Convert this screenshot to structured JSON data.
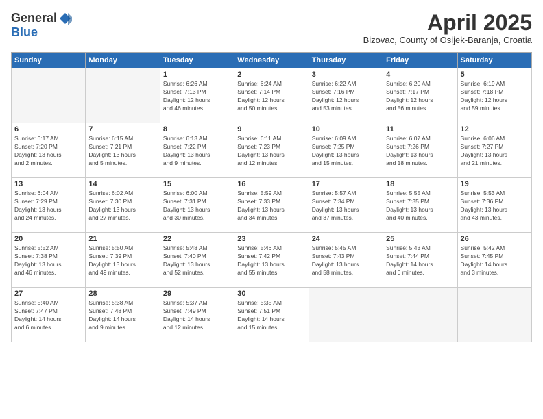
{
  "header": {
    "logo_general": "General",
    "logo_blue": "Blue",
    "month_title": "April 2025",
    "location": "Bizovac, County of Osijek-Baranja, Croatia"
  },
  "days_of_week": [
    "Sunday",
    "Monday",
    "Tuesday",
    "Wednesday",
    "Thursday",
    "Friday",
    "Saturday"
  ],
  "weeks": [
    [
      {
        "day": "",
        "info": ""
      },
      {
        "day": "",
        "info": ""
      },
      {
        "day": "1",
        "info": "Sunrise: 6:26 AM\nSunset: 7:13 PM\nDaylight: 12 hours\nand 46 minutes."
      },
      {
        "day": "2",
        "info": "Sunrise: 6:24 AM\nSunset: 7:14 PM\nDaylight: 12 hours\nand 50 minutes."
      },
      {
        "day": "3",
        "info": "Sunrise: 6:22 AM\nSunset: 7:16 PM\nDaylight: 12 hours\nand 53 minutes."
      },
      {
        "day": "4",
        "info": "Sunrise: 6:20 AM\nSunset: 7:17 PM\nDaylight: 12 hours\nand 56 minutes."
      },
      {
        "day": "5",
        "info": "Sunrise: 6:19 AM\nSunset: 7:18 PM\nDaylight: 12 hours\nand 59 minutes."
      }
    ],
    [
      {
        "day": "6",
        "info": "Sunrise: 6:17 AM\nSunset: 7:20 PM\nDaylight: 13 hours\nand 2 minutes."
      },
      {
        "day": "7",
        "info": "Sunrise: 6:15 AM\nSunset: 7:21 PM\nDaylight: 13 hours\nand 5 minutes."
      },
      {
        "day": "8",
        "info": "Sunrise: 6:13 AM\nSunset: 7:22 PM\nDaylight: 13 hours\nand 9 minutes."
      },
      {
        "day": "9",
        "info": "Sunrise: 6:11 AM\nSunset: 7:23 PM\nDaylight: 13 hours\nand 12 minutes."
      },
      {
        "day": "10",
        "info": "Sunrise: 6:09 AM\nSunset: 7:25 PM\nDaylight: 13 hours\nand 15 minutes."
      },
      {
        "day": "11",
        "info": "Sunrise: 6:07 AM\nSunset: 7:26 PM\nDaylight: 13 hours\nand 18 minutes."
      },
      {
        "day": "12",
        "info": "Sunrise: 6:06 AM\nSunset: 7:27 PM\nDaylight: 13 hours\nand 21 minutes."
      }
    ],
    [
      {
        "day": "13",
        "info": "Sunrise: 6:04 AM\nSunset: 7:29 PM\nDaylight: 13 hours\nand 24 minutes."
      },
      {
        "day": "14",
        "info": "Sunrise: 6:02 AM\nSunset: 7:30 PM\nDaylight: 13 hours\nand 27 minutes."
      },
      {
        "day": "15",
        "info": "Sunrise: 6:00 AM\nSunset: 7:31 PM\nDaylight: 13 hours\nand 30 minutes."
      },
      {
        "day": "16",
        "info": "Sunrise: 5:59 AM\nSunset: 7:33 PM\nDaylight: 13 hours\nand 34 minutes."
      },
      {
        "day": "17",
        "info": "Sunrise: 5:57 AM\nSunset: 7:34 PM\nDaylight: 13 hours\nand 37 minutes."
      },
      {
        "day": "18",
        "info": "Sunrise: 5:55 AM\nSunset: 7:35 PM\nDaylight: 13 hours\nand 40 minutes."
      },
      {
        "day": "19",
        "info": "Sunrise: 5:53 AM\nSunset: 7:36 PM\nDaylight: 13 hours\nand 43 minutes."
      }
    ],
    [
      {
        "day": "20",
        "info": "Sunrise: 5:52 AM\nSunset: 7:38 PM\nDaylight: 13 hours\nand 46 minutes."
      },
      {
        "day": "21",
        "info": "Sunrise: 5:50 AM\nSunset: 7:39 PM\nDaylight: 13 hours\nand 49 minutes."
      },
      {
        "day": "22",
        "info": "Sunrise: 5:48 AM\nSunset: 7:40 PM\nDaylight: 13 hours\nand 52 minutes."
      },
      {
        "day": "23",
        "info": "Sunrise: 5:46 AM\nSunset: 7:42 PM\nDaylight: 13 hours\nand 55 minutes."
      },
      {
        "day": "24",
        "info": "Sunrise: 5:45 AM\nSunset: 7:43 PM\nDaylight: 13 hours\nand 58 minutes."
      },
      {
        "day": "25",
        "info": "Sunrise: 5:43 AM\nSunset: 7:44 PM\nDaylight: 14 hours\nand 0 minutes."
      },
      {
        "day": "26",
        "info": "Sunrise: 5:42 AM\nSunset: 7:45 PM\nDaylight: 14 hours\nand 3 minutes."
      }
    ],
    [
      {
        "day": "27",
        "info": "Sunrise: 5:40 AM\nSunset: 7:47 PM\nDaylight: 14 hours\nand 6 minutes."
      },
      {
        "day": "28",
        "info": "Sunrise: 5:38 AM\nSunset: 7:48 PM\nDaylight: 14 hours\nand 9 minutes."
      },
      {
        "day": "29",
        "info": "Sunrise: 5:37 AM\nSunset: 7:49 PM\nDaylight: 14 hours\nand 12 minutes."
      },
      {
        "day": "30",
        "info": "Sunrise: 5:35 AM\nSunset: 7:51 PM\nDaylight: 14 hours\nand 15 minutes."
      },
      {
        "day": "",
        "info": ""
      },
      {
        "day": "",
        "info": ""
      },
      {
        "day": "",
        "info": ""
      }
    ]
  ]
}
